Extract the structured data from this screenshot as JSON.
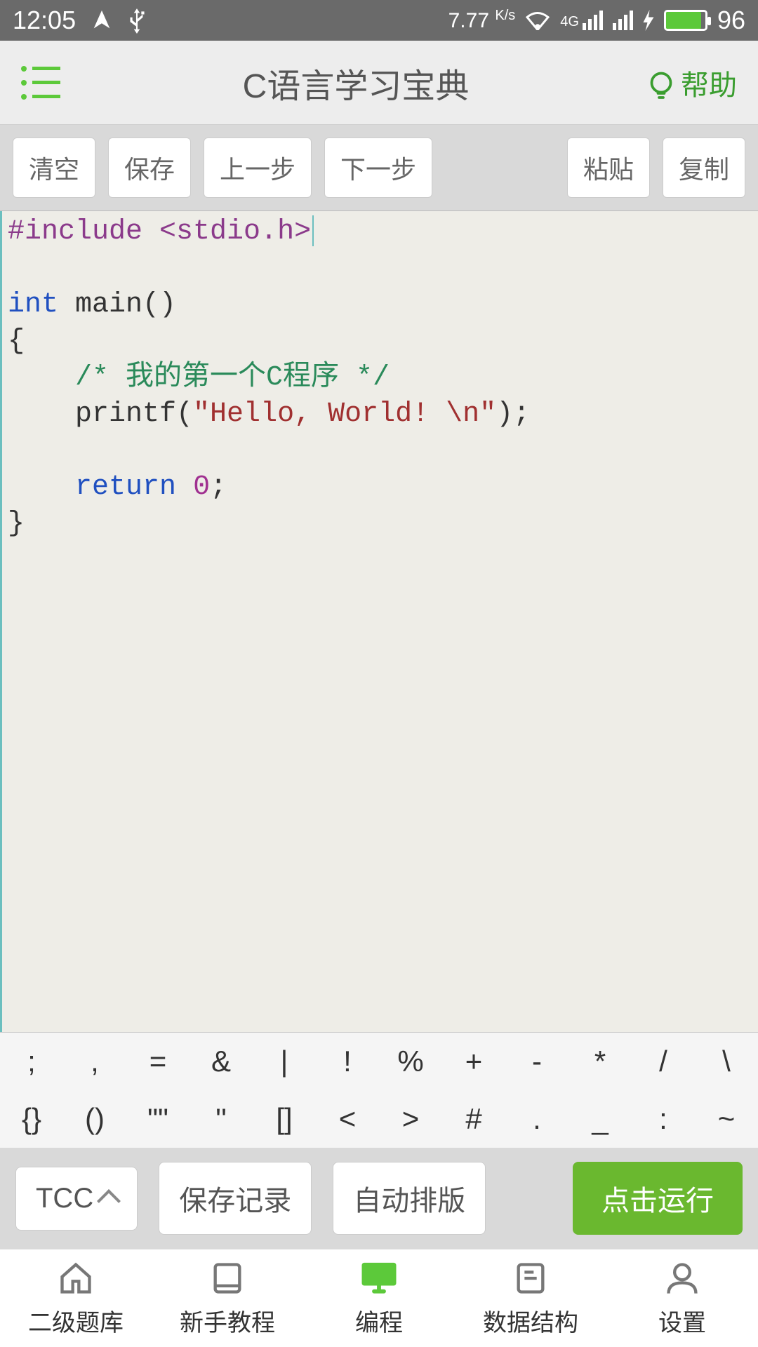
{
  "status": {
    "time": "12:05",
    "net_speed": "7.77",
    "net_unit": "K/s",
    "net_type": "4G",
    "battery": "96"
  },
  "header": {
    "title": "C语言学习宝典",
    "help": "帮助"
  },
  "toolbar": {
    "clear": "清空",
    "save": "保存",
    "undo": "上一步",
    "redo": "下一步",
    "paste": "粘贴",
    "copy": "复制"
  },
  "code": {
    "line1_pre": "#include <stdio.h>",
    "line3_kw": "int",
    "line3_rest": " main()",
    "line4": "{",
    "line5_indent": "    ",
    "line5_com": "/* 我的第一个C程序 */",
    "line6_indent": "    ",
    "line6a": "printf(",
    "line6_str": "\"Hello, World! \\n\"",
    "line6b": ");",
    "line8_indent": "    ",
    "line8_kw": "return",
    "line8_sp": " ",
    "line8_num": "0",
    "line8_semi": ";",
    "line9": "}"
  },
  "symbols": {
    "row1": [
      ";",
      ",",
      "=",
      "&",
      "|",
      "!",
      "%",
      "+",
      "-",
      "*",
      "/",
      "\\"
    ],
    "row2": [
      "{}",
      "()",
      "\"\"",
      "''",
      "[]",
      "<",
      ">",
      "#",
      ".",
      "_",
      ":",
      "~"
    ]
  },
  "actions": {
    "compiler": "TCC",
    "history": "保存记录",
    "format": "自动排版",
    "run": "点击运行"
  },
  "nav": {
    "items": [
      {
        "label": "二级题库"
      },
      {
        "label": "新手教程"
      },
      {
        "label": "编程"
      },
      {
        "label": "数据结构"
      },
      {
        "label": "设置"
      }
    ],
    "active_index": 2
  }
}
